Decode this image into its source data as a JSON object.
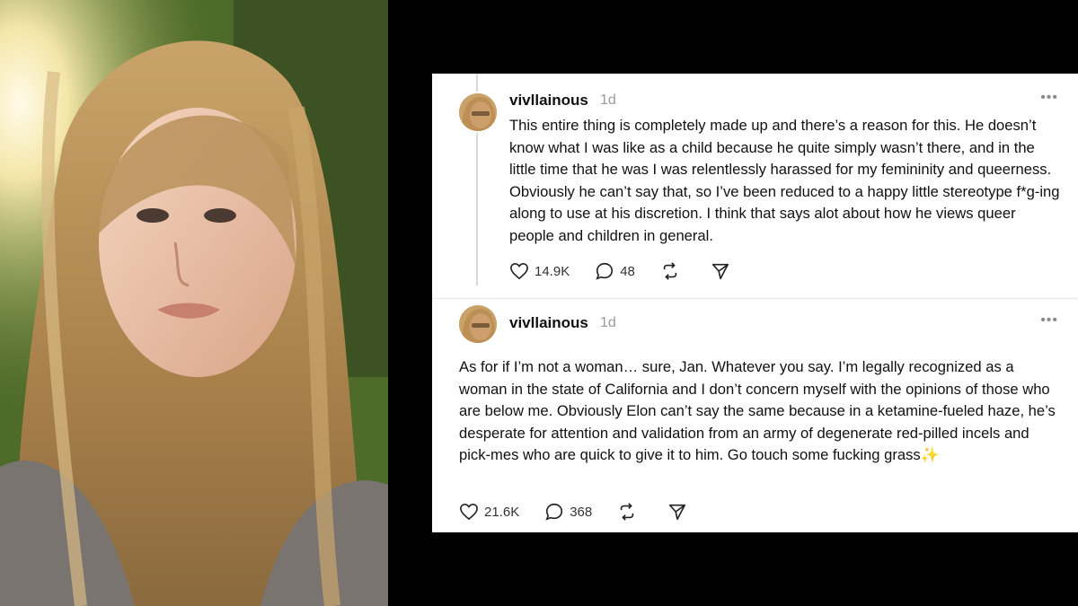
{
  "posts": [
    {
      "username": "vivllainous",
      "time": "1d",
      "more": "•••",
      "text": "This entire thing is completely made up and there’s a reason for this. He doesn’t know what I was like as a child because he quite simply wasn’t there, and in the little time that he was I was relentlessly harassed for my femininity and queerness. Obviously he can’t say that, so I’ve been reduced to a happy little stereotype f*g-ing along to use at his discretion. I think that says alot about how he views queer people and children in general.",
      "likes": "14.9K",
      "replies": "48"
    },
    {
      "username": "vivllainous",
      "time": "1d",
      "more": "•••",
      "text": "As for if I’m not a woman… sure, Jan. Whatever you say. I’m legally recognized as a woman in the state of California and I don’t concern myself with the opinions of those who are below me. Obviously Elon can’t say the same because in a ketamine-fueled haze, he’s desperate for attention and validation from an army of degenerate red-pilled incels and pick-mes who are quick to give it to him. Go touch some fucking grass",
      "emoji": "✨",
      "likes": "21.6K",
      "replies": "368"
    }
  ],
  "icons": [
    "heart-icon",
    "reply-icon",
    "repost-icon",
    "share-icon",
    "more-icon"
  ]
}
